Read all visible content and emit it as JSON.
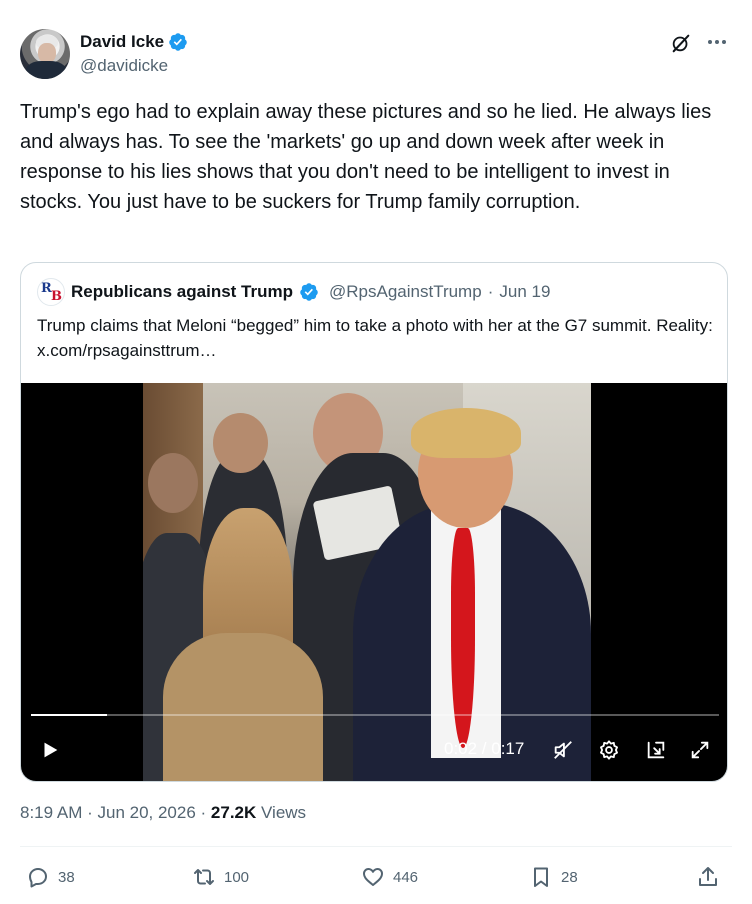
{
  "author": {
    "display_name": "David Icke",
    "handle": "@davidicke",
    "verified": true,
    "avatar_icon": "profile-photo"
  },
  "post": {
    "text": "Trump's ego had to explain away these pictures and so he lied. He always lies and always has. To see the 'markets' go up and down week after week in response to his lies shows that you don't need to be intelligent to invest in stocks. You just have to be suckers for Trump family corruption."
  },
  "quoted": {
    "display_name": "Republicans against Trump",
    "handle": "@RpsAgainstTrump",
    "separator": "·",
    "date": "Jun 19",
    "text": "Trump claims that Meloni “begged” him to take a photo with her at the G7 summit. Reality:  x.com/rpsagainsttrum…",
    "avatar_letters": {
      "top": "R",
      "bottom": "B"
    }
  },
  "video": {
    "time_display": "0:02 / 0:17",
    "progress_fraction": 0.11,
    "controls": [
      "play-icon",
      "mute-icon",
      "settings-icon",
      "pip-icon",
      "fullscreen-icon"
    ]
  },
  "meta": {
    "time": "8:19 AM",
    "sep1": " · ",
    "date": "Jun 20, 2026",
    "sep2": " · ",
    "views_count": "27.2K",
    "views_label": " Views"
  },
  "actions": {
    "replies": "38",
    "reposts": "100",
    "likes": "446",
    "bookmarks": "28"
  },
  "colors": {
    "verified_blue": "#1d9bf0",
    "secondary_text": "#536471",
    "primary_text": "#0f1419",
    "border": "#cfd9de"
  }
}
